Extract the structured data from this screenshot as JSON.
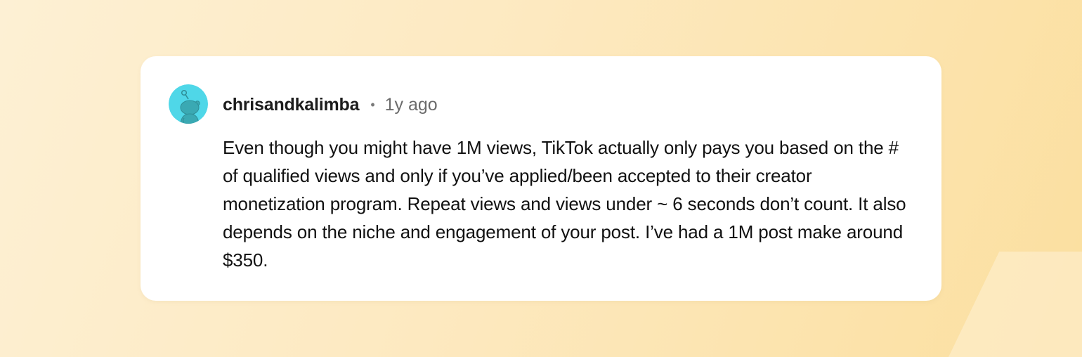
{
  "comment": {
    "avatar_icon": "reddit-snoo-avatar-icon",
    "username": "chrisandkalimba",
    "separator": "•",
    "timestamp": "1y ago",
    "body": "Even though you might have 1M views, TikTok actually only pays you based on the # of qualified views and only if you’ve applied/been accepted to their creator monetization program. Repeat views and views under ~ 6 seconds don’t count. It also depends on the niche and engagement of your post. I’ve had a 1M post make around $350."
  },
  "colors": {
    "avatar_background": "#4fd7e8",
    "avatar_figure": "#3aa9b3",
    "card_background": "#ffffff",
    "page_background": "#fde9c0"
  }
}
